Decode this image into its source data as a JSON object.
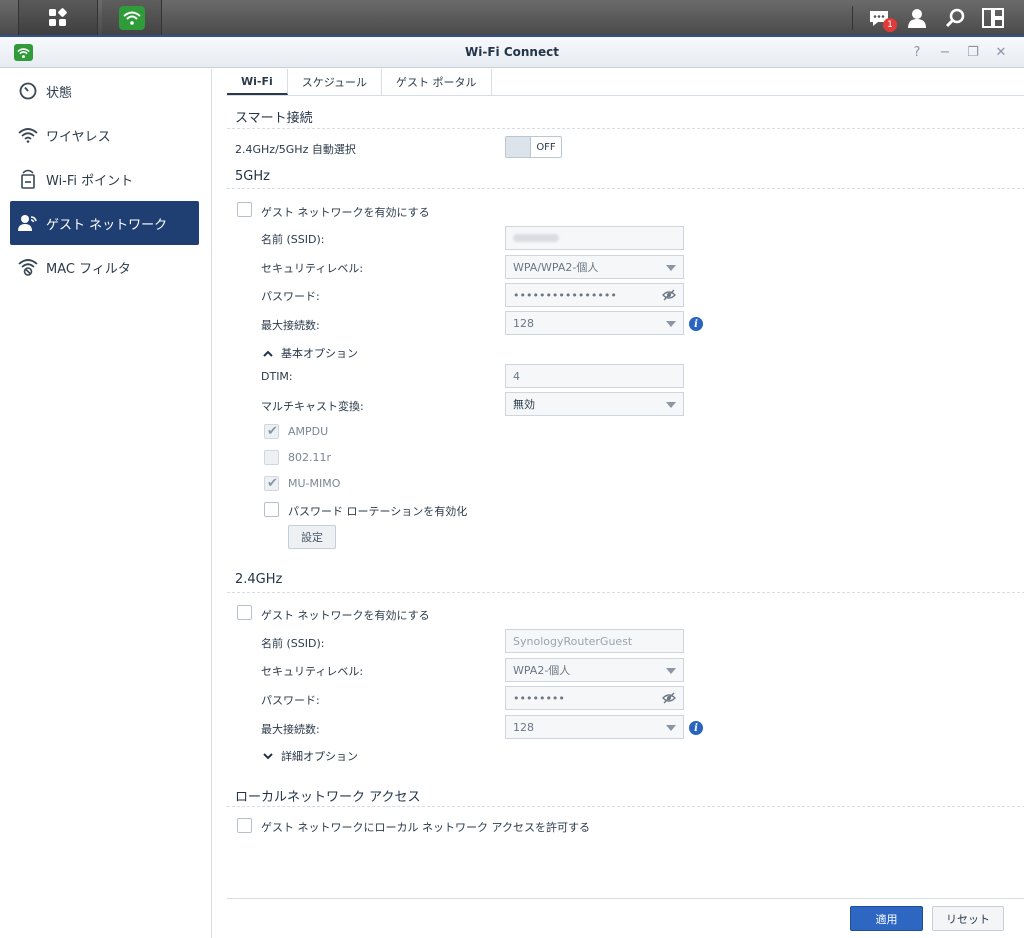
{
  "taskbar": {
    "notification_count": "1",
    "icons": [
      "main-menu-icon",
      "wifi-app-icon",
      "notification-icon",
      "user-icon",
      "search-icon",
      "widgets-icon"
    ]
  },
  "window": {
    "title": "Wi-Fi Connect",
    "controls": [
      "?",
      "−",
      "❐",
      "✕"
    ]
  },
  "sidebar": {
    "items": [
      {
        "label": "状態",
        "icon": "status-icon"
      },
      {
        "label": "ワイヤレス",
        "icon": "wireless-icon"
      },
      {
        "label": "Wi-Fi ポイント",
        "icon": "wifi-point-icon"
      },
      {
        "label": "ゲスト ネットワーク",
        "icon": "guest-network-icon"
      },
      {
        "label": "MAC フィルタ",
        "icon": "mac-filter-icon"
      }
    ],
    "active_index": 3
  },
  "tabs": [
    "Wi-Fi",
    "スケジュール",
    "ゲスト ポータル"
  ],
  "smart_connect": {
    "title": "スマート接続",
    "auto_select_label": "2.4GHz/5GHz 自動選択",
    "toggle_label": "OFF"
  },
  "band5": {
    "title": "5GHz",
    "enable_label": "ゲスト ネットワークを有効にする",
    "ssid_label": "名前 (SSID):",
    "ssid_value": "",
    "security_label": "セキュリティレベル:",
    "security_value": "WPA/WPA2-個人",
    "password_label": "パスワード:",
    "password_value": "••••••••••••••••",
    "max_conn_label": "最大接続数:",
    "max_conn_value": "128",
    "basic_options_label": "基本オプション",
    "dtim_label": "DTIM:",
    "dtim_value": "4",
    "multicast_label": "マルチキャスト変換:",
    "multicast_value": "無効",
    "ampdu_label": "AMPDU",
    "r80211_label": "802.11r",
    "mumimo_label": "MU-MIMO",
    "pw_rotation_label": "パスワード ローテーションを有効化",
    "settings_button": "設定"
  },
  "band24": {
    "title": "2.4GHz",
    "enable_label": "ゲスト ネットワークを有効にする",
    "ssid_label": "名前 (SSID):",
    "ssid_value": "SynologyRouterGuest",
    "security_label": "セキュリティレベル:",
    "security_value": "WPA2-個人",
    "password_label": "パスワード:",
    "password_value": "••••••••",
    "max_conn_label": "最大接続数:",
    "max_conn_value": "128",
    "advanced_options_label": "詳細オプション"
  },
  "local_access": {
    "title": "ローカルネットワーク アクセス",
    "allow_label": "ゲスト ネットワークにローカル ネットワーク アクセスを許可する"
  },
  "footer": {
    "apply_label": "適用",
    "reset_label": "リセット"
  }
}
